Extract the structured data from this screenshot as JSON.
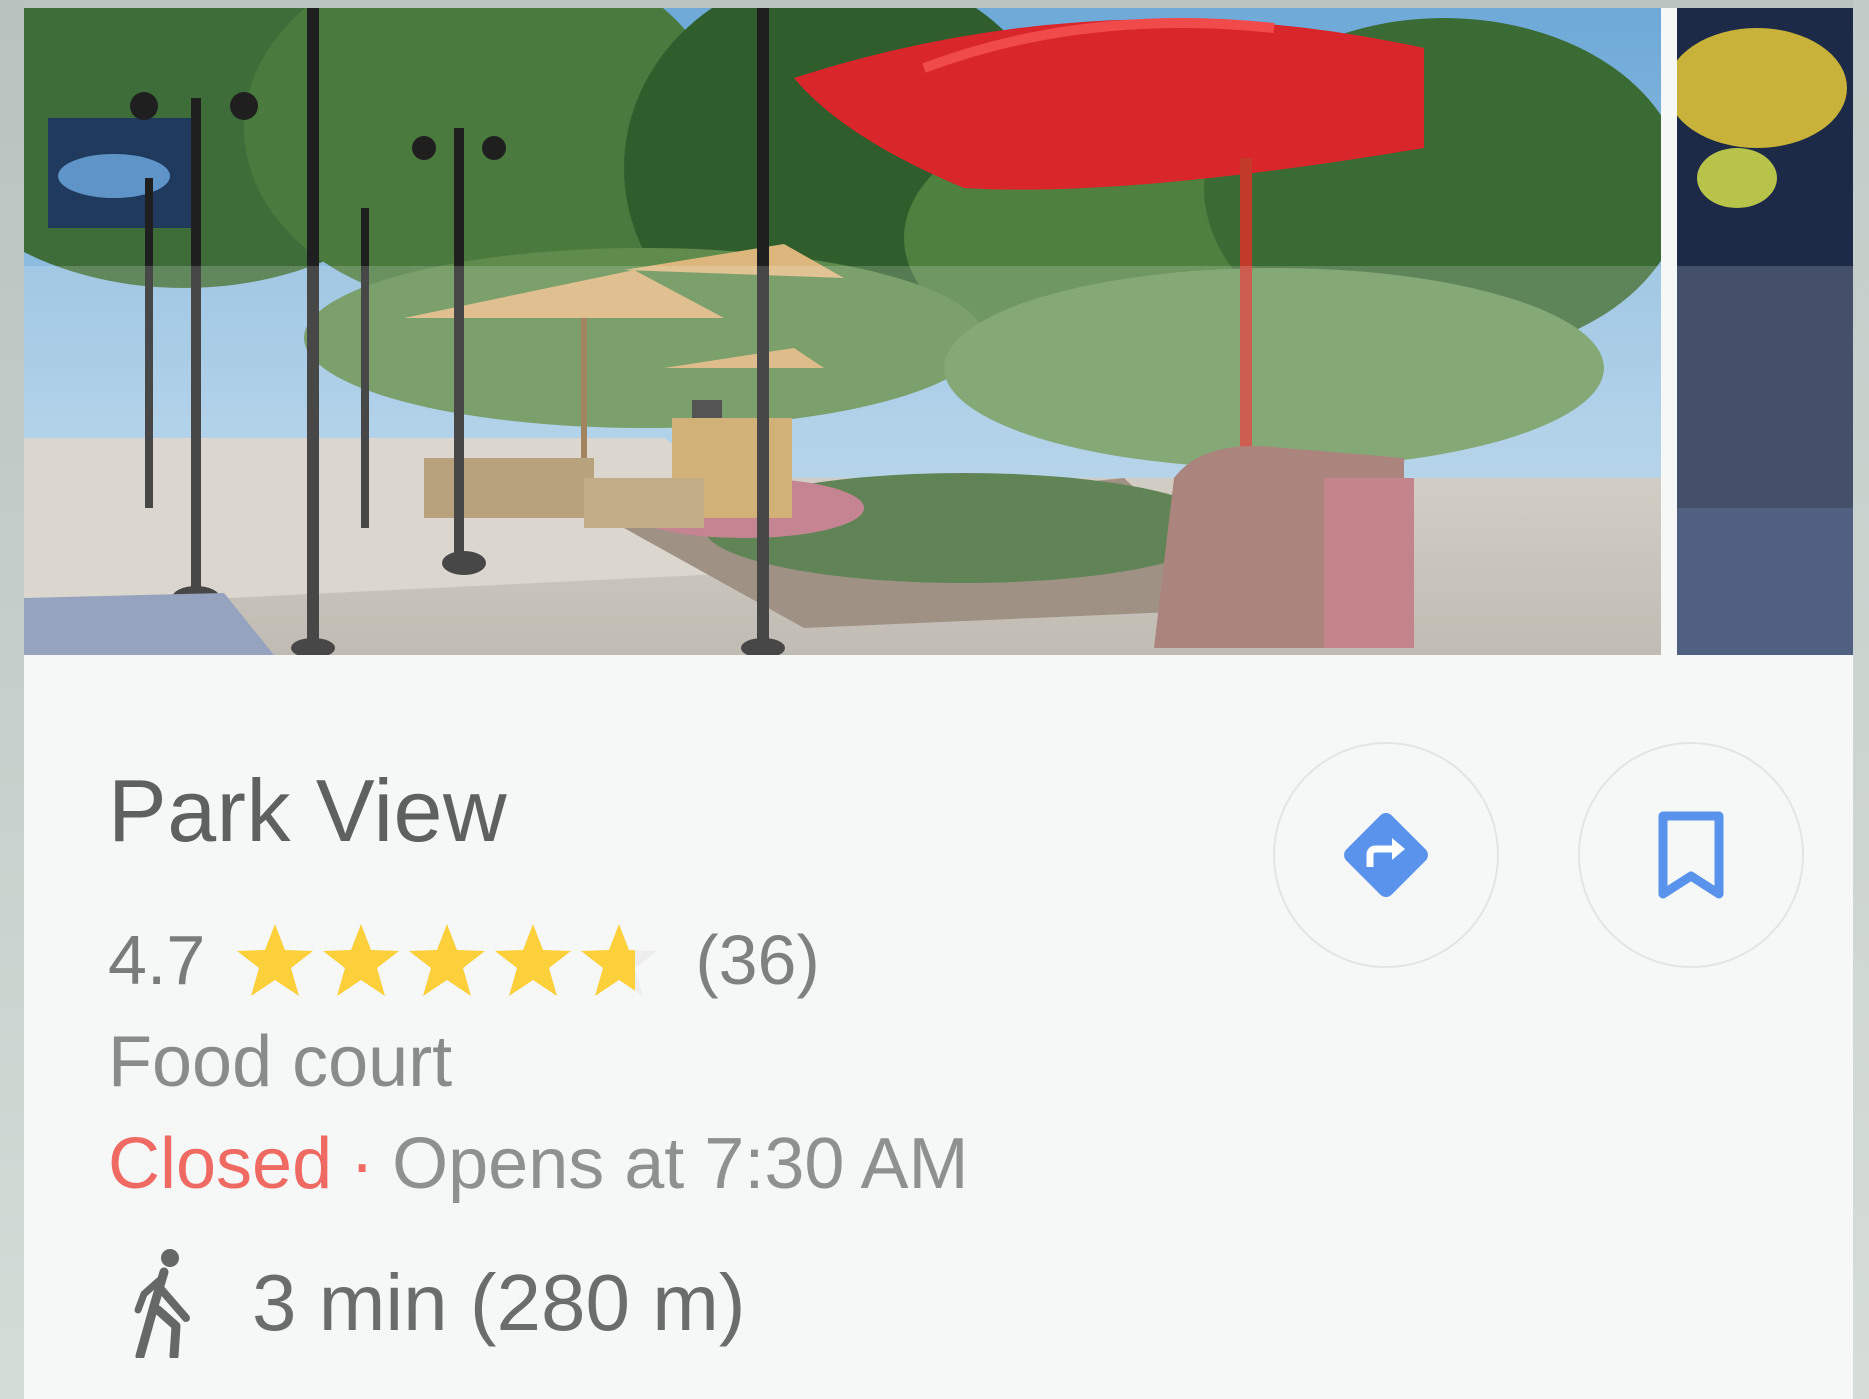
{
  "place": {
    "name": "Park View",
    "rating": "4.7",
    "rating_value": 4.7,
    "rating_max": 5,
    "review_count": "(36)",
    "category": "Food court",
    "status": "Closed",
    "separator": "·",
    "opens_text": "Opens at 7:30 AM",
    "walk_text": "3 min (280 m)"
  },
  "actions": {
    "directions_icon": "directions-icon",
    "save_icon": "bookmark-icon"
  },
  "colors": {
    "accent_blue": "#5a93ec",
    "star_yellow": "#fbd03a",
    "closed_red": "#ef6a62",
    "text_gray": "#5f6161"
  }
}
